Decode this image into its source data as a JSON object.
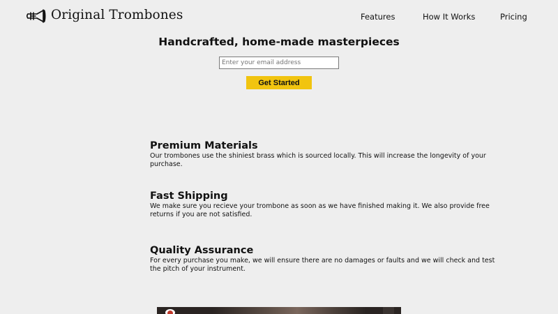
{
  "header": {
    "brand_name": "Original Trombones",
    "logo_icon": "trombone-icon",
    "nav": {
      "features": "Features",
      "how_it_works": "How It Works",
      "pricing": "Pricing"
    }
  },
  "hero": {
    "title": "Handcrafted, home-made masterpieces",
    "email_placeholder": "Enter your email address",
    "email_value": "",
    "cta_label": "Get Started"
  },
  "features": [
    {
      "title": "Premium Materials",
      "description": "Our trombones use the shiniest brass which is sourced locally. This will increase the longevity of your purchase."
    },
    {
      "title": "Fast Shipping",
      "description": "We make sure you recieve your trombone as soon as we have finished making it. We also provide free returns if you are not satisfied."
    },
    {
      "title": "Quality Assurance",
      "description": "For every purchase you make, we will ensure there are no damages or faults and we will check and test the pitch of your instrument."
    }
  ],
  "colors": {
    "background": "#eeeeee",
    "cta": "#f1c40f",
    "text": "#111111"
  }
}
